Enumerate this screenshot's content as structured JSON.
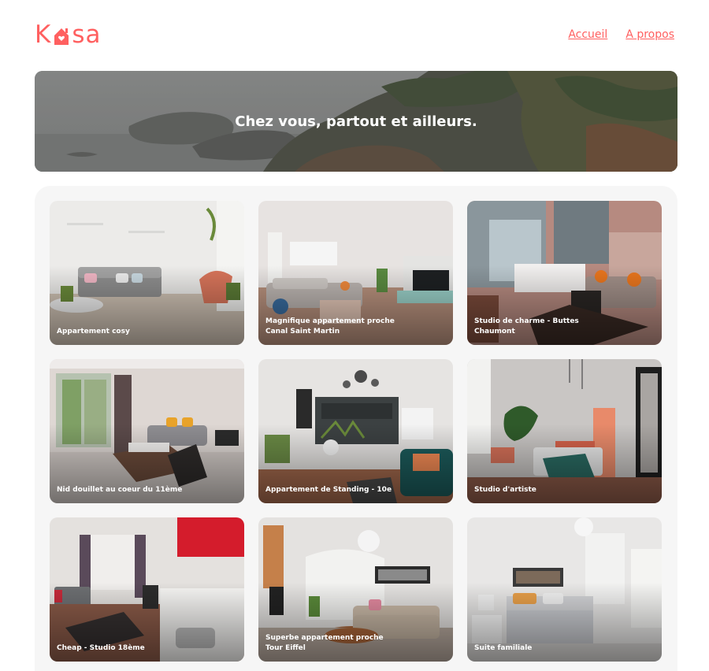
{
  "header": {
    "logo_prefix": "K",
    "logo_suffix": "sa",
    "nav": [
      {
        "label": "Accueil"
      },
      {
        "label": "A propos"
      }
    ]
  },
  "banner": {
    "title": "Chez vous, partout et ailleurs."
  },
  "gallery": {
    "cards": [
      {
        "title": "Appartement cosy",
        "scene": "cosy"
      },
      {
        "title": "Magnifique appartement proche Canal Saint Martin",
        "scene": "canal"
      },
      {
        "title": "Studio de charme - Buttes Chaumont",
        "scene": "buttes"
      },
      {
        "title": "Nid douillet au coeur du 11ème",
        "scene": "nid"
      },
      {
        "title": "Appartement de Standing - 10e",
        "scene": "standing"
      },
      {
        "title": "Studio d'artiste",
        "scene": "artiste"
      },
      {
        "title": "Cheap - Studio 18ème",
        "scene": "cheap"
      },
      {
        "title": "Superbe appartement proche Tour Eiffel",
        "scene": "eiffel"
      },
      {
        "title": "Suite familiale",
        "scene": "familiale"
      }
    ]
  },
  "colors": {
    "brand": "#ff6060",
    "gallery_bg": "#f6f6f6"
  },
  "icons": {
    "logo_house": "house-icon"
  }
}
